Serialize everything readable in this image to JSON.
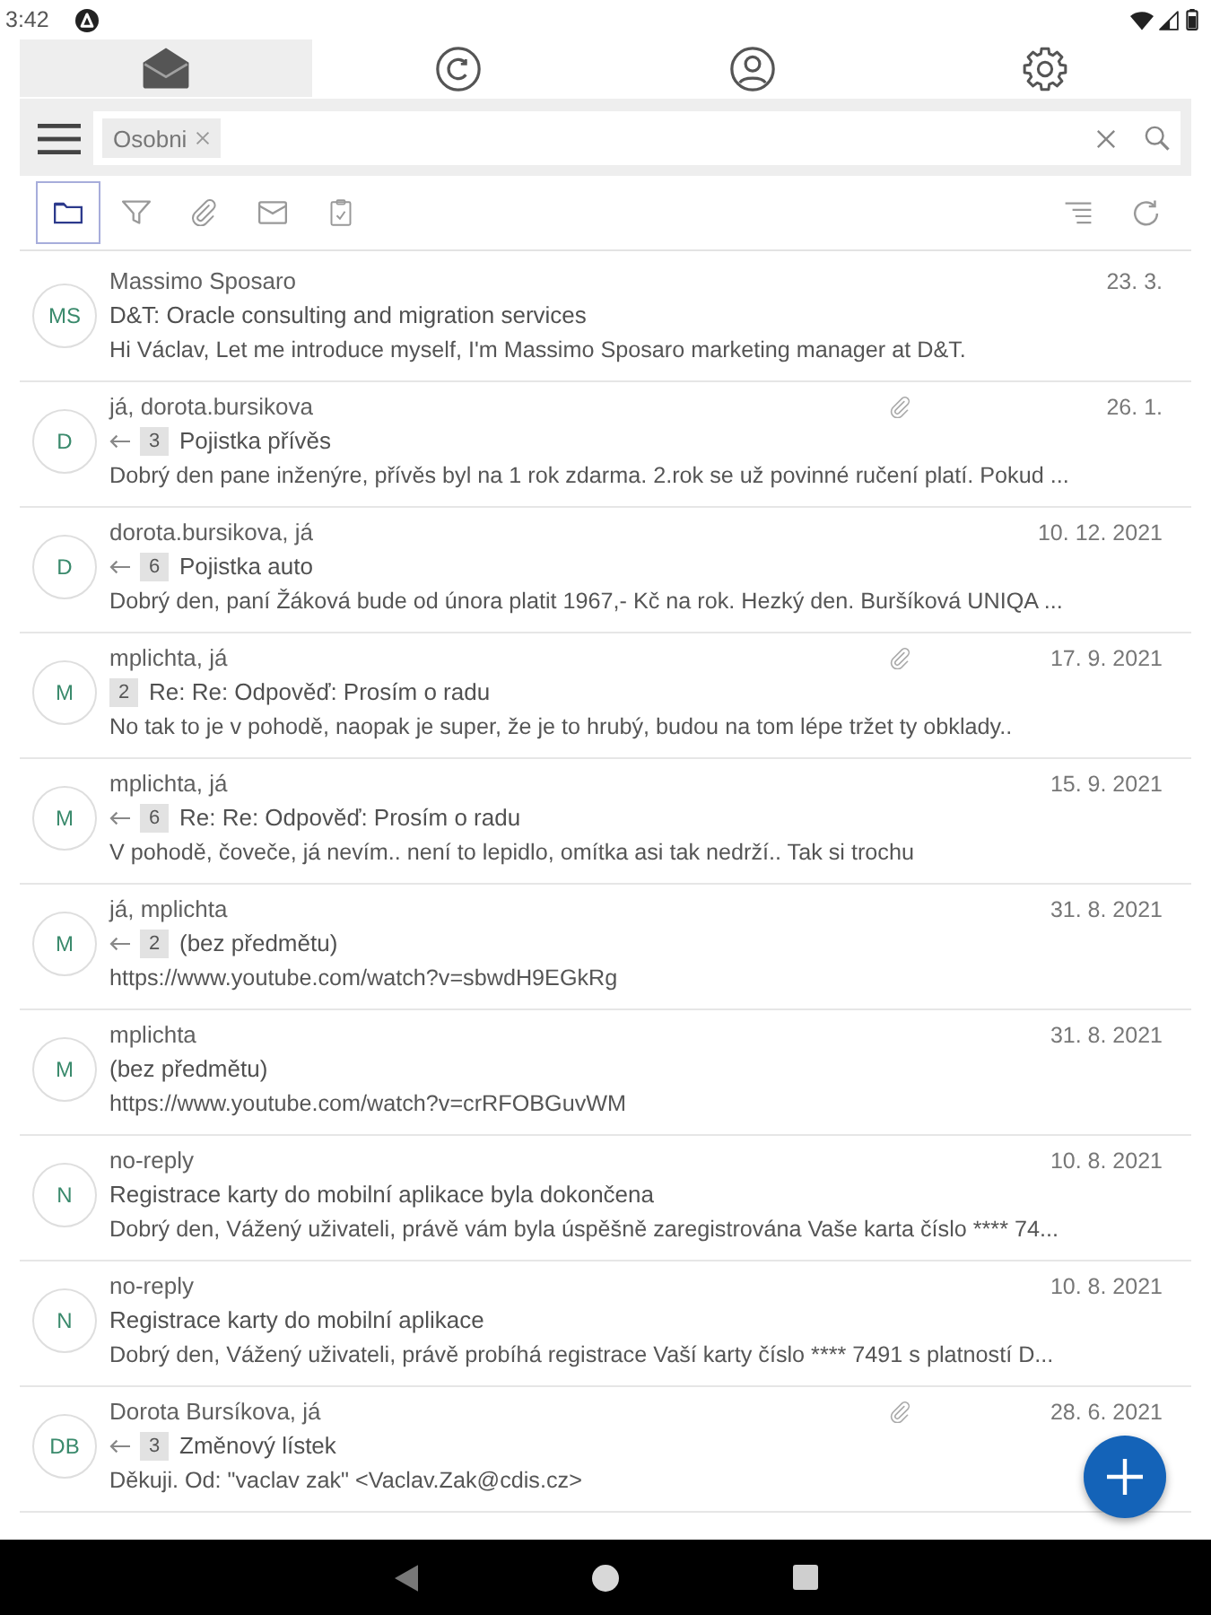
{
  "status_bar": {
    "time": "3:42"
  },
  "tabs": [
    {
      "kind": "mail",
      "selected": true
    },
    {
      "kind": "copyright",
      "selected": false
    },
    {
      "kind": "account",
      "selected": false
    },
    {
      "kind": "settings",
      "selected": false
    }
  ],
  "search": {
    "chips": [
      {
        "label": "Osobni"
      }
    ]
  },
  "toolbar": {
    "filters": [
      {
        "kind": "folder",
        "selected": true
      },
      {
        "kind": "filter",
        "selected": false
      },
      {
        "kind": "attachment",
        "selected": false
      },
      {
        "kind": "unread",
        "selected": false
      },
      {
        "kind": "task",
        "selected": false
      }
    ],
    "actions": [
      {
        "kind": "sort"
      },
      {
        "kind": "refresh"
      }
    ]
  },
  "messages": [
    {
      "initials": "MS",
      "sender": "Massimo Sposaro",
      "date": "23. 3.",
      "attachment": false,
      "replied": false,
      "subject": "D&T: Oracle consulting and migration services",
      "preview": "Hi Václav, Let me introduce myself, I'm Massimo Sposaro marketing manager at D&T."
    },
    {
      "initials": "D",
      "sender": "já, dorota.bursikova",
      "date": "26. 1.",
      "attachment": true,
      "replied": true,
      "thread_count": "3",
      "subject": "Pojistka přívěs",
      "preview": "Dobrý den pane inženýre, přívěs byl na 1 rok zdarma. 2.rok se už povinné ručení platí. Pokud ..."
    },
    {
      "initials": "D",
      "sender": "dorota.bursikova, já",
      "date": "10. 12. 2021",
      "attachment": false,
      "replied": true,
      "thread_count": "6",
      "subject": "Pojistka auto",
      "preview": "Dobrý den, paní Žáková bude od února platit 1967,- Kč na rok. Hezký den. Buršíková UNIQA ..."
    },
    {
      "initials": "M",
      "sender": "mplichta, já",
      "date": "17. 9. 2021",
      "attachment": true,
      "replied": false,
      "thread_count": "2",
      "subject": "Re: Re: Odpověď: Prosím o radu",
      "preview": "No tak to je v pohodě, naopak je super, že je to hrubý, budou na tom lépe tržet ty obklady.."
    },
    {
      "initials": "M",
      "sender": "mplichta, já",
      "date": "15. 9. 2021",
      "attachment": false,
      "replied": true,
      "thread_count": "6",
      "subject": "Re: Re: Odpověď: Prosím o radu",
      "preview": "V pohodě, čoveče, já nevím.. není to lepidlo, omítka asi tak nedrží.. Tak si trochu"
    },
    {
      "initials": "M",
      "sender": "já, mplichta",
      "date": "31. 8. 2021",
      "attachment": false,
      "replied": true,
      "thread_count": "2",
      "subject": "(bez předmětu)",
      "preview": "https://www.youtube.com/watch?v=sbwdH9EGkRg"
    },
    {
      "initials": "M",
      "sender": "mplichta",
      "date": "31. 8. 2021",
      "attachment": false,
      "replied": false,
      "subject": "(bez předmětu)",
      "preview": "https://www.youtube.com/watch?v=crRFOBGuvWM"
    },
    {
      "initials": "N",
      "sender": "no-reply",
      "date": "10. 8. 2021",
      "attachment": false,
      "replied": false,
      "subject": "Registrace karty do mobilní aplikace byla dokončena",
      "preview": "Dobrý den, Vážený uživateli, právě vám byla úspěšně zaregistrována Vaše karta číslo **** 74..."
    },
    {
      "initials": "N",
      "sender": "no-reply",
      "date": "10. 8. 2021",
      "attachment": false,
      "replied": false,
      "subject": "Registrace karty do mobilní aplikace",
      "preview": "Dobrý den, Vážený uživateli, právě probíhá registrace Vaší karty číslo **** 7491 s platností D..."
    },
    {
      "initials": "DB",
      "sender": "Dorota Bursíkova, já",
      "date": "28. 6. 2021",
      "attachment": true,
      "replied": true,
      "thread_count": "3",
      "subject": "Změnový lístek",
      "preview": "Děkuji. Od: \"vaclav zak\" <Vaclav.Zak@cdis.cz>"
    }
  ]
}
